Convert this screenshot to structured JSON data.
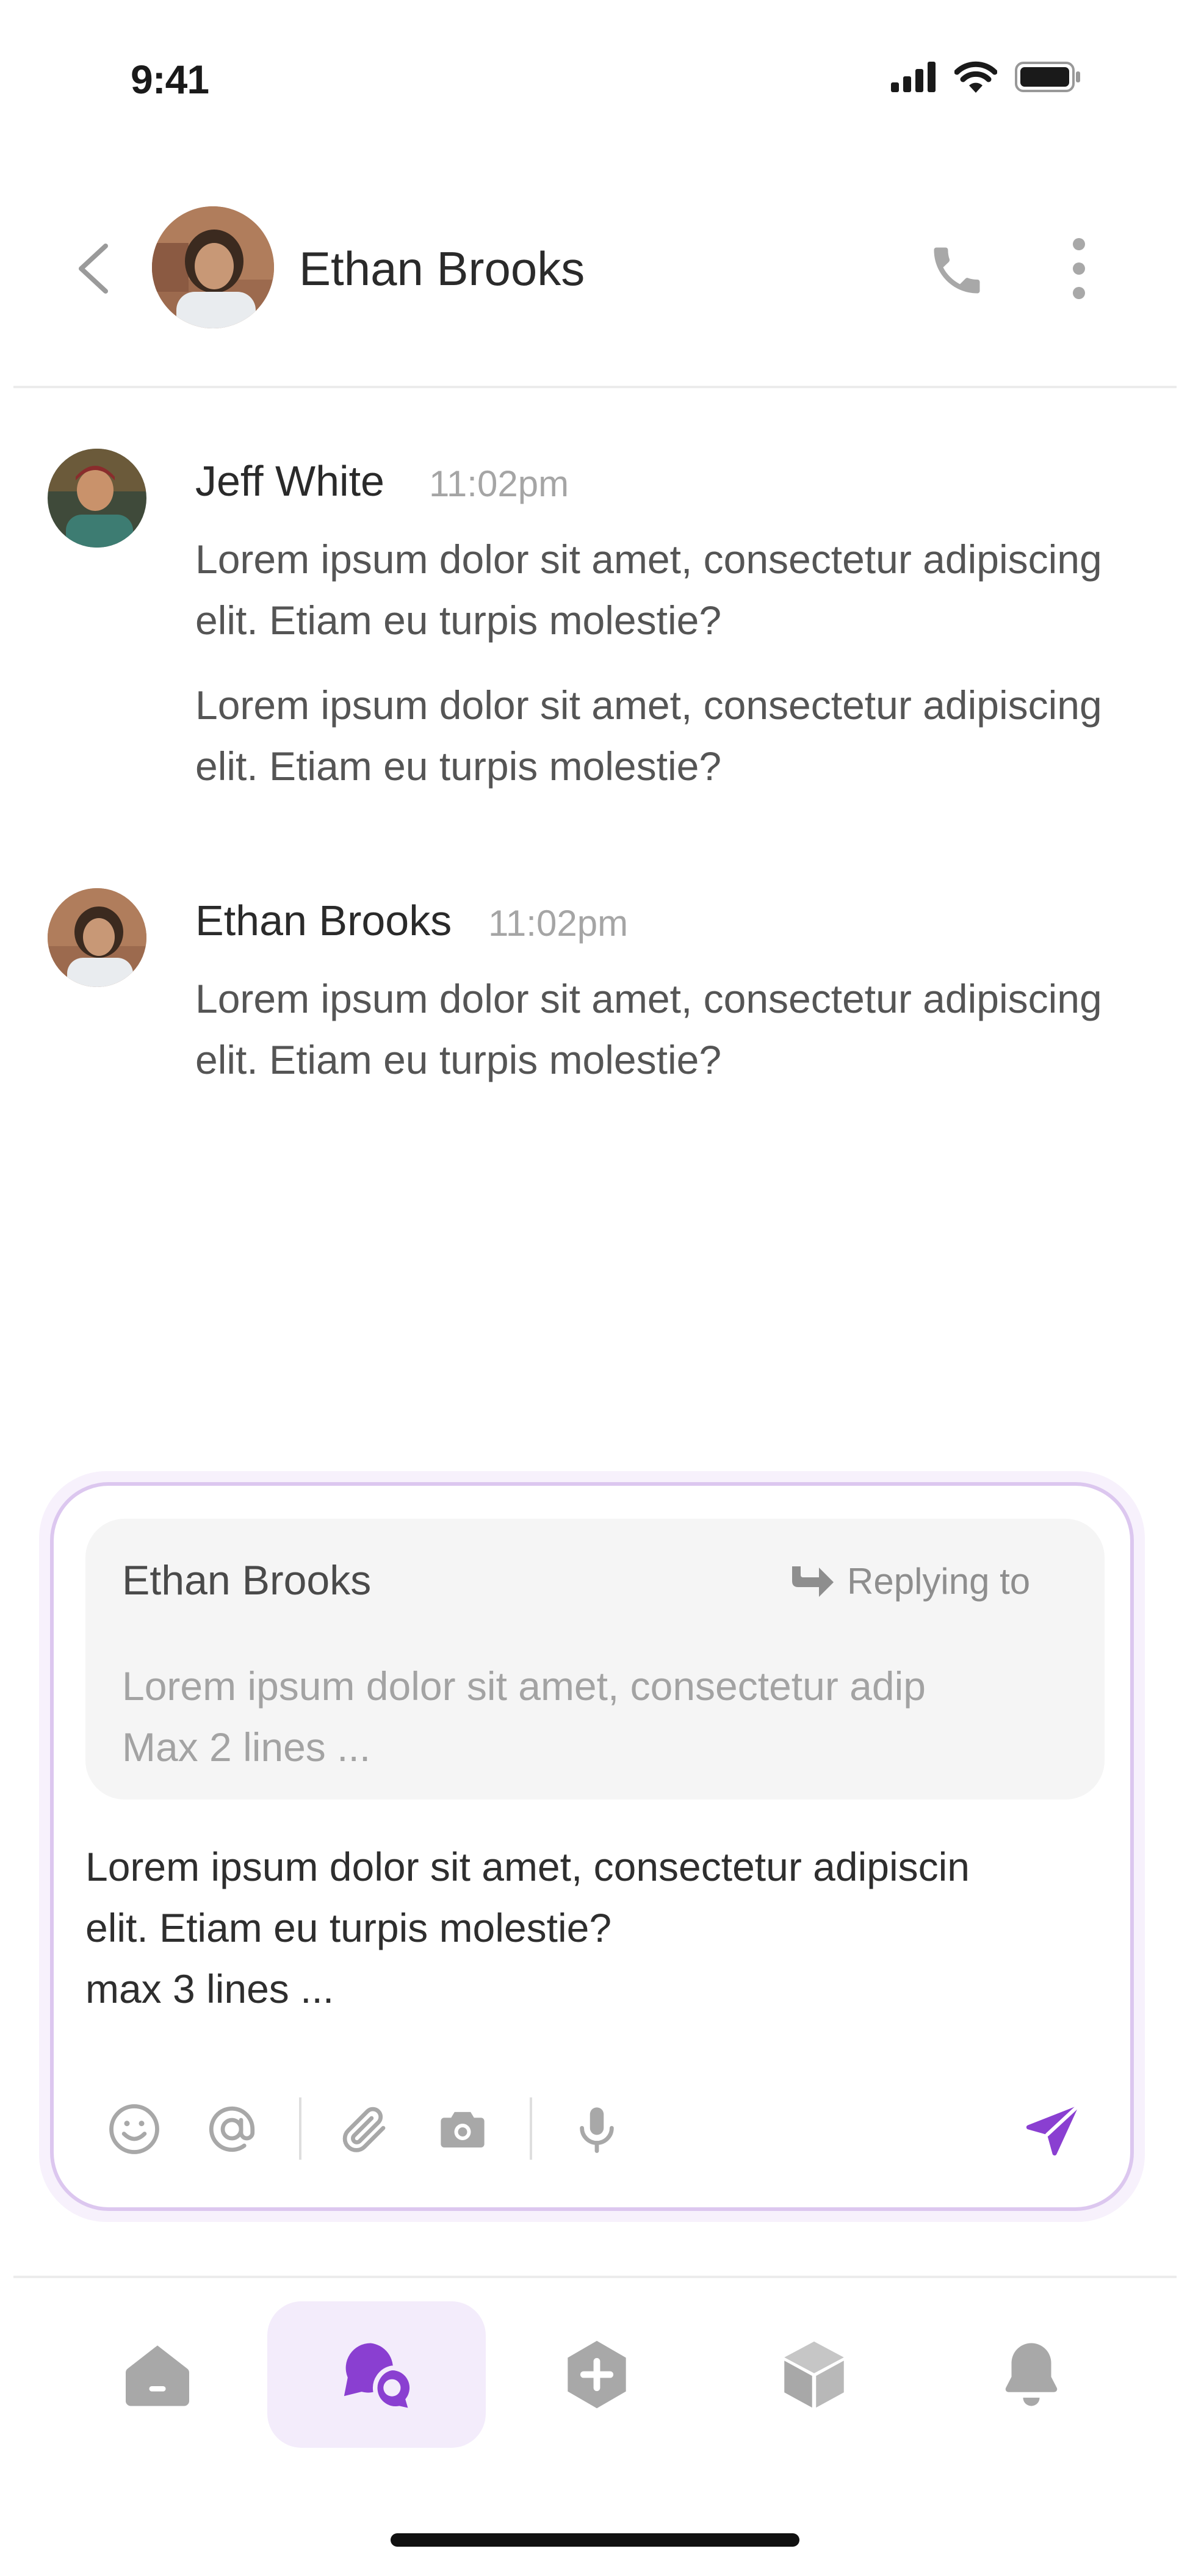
{
  "status_bar": {
    "time": "9:41"
  },
  "header": {
    "title": "Ethan Brooks"
  },
  "messages": [
    {
      "author": "Jeff White",
      "time": "11:02pm",
      "paragraphs": [
        "Lorem ipsum dolor sit amet, consectetur adipiscing elit. Etiam eu turpis molestie?",
        "Lorem ipsum dolor sit amet, consectetur adipiscing elit. Etiam eu turpis molestie?"
      ]
    },
    {
      "author": "Ethan Brooks",
      "time": "11:02pm",
      "paragraphs": [
        "Lorem ipsum dolor sit amet, consectetur adipiscing elit. Etiam eu turpis molestie?"
      ]
    }
  ],
  "composer": {
    "reply": {
      "name": "Ethan Brooks",
      "label": "Replying to",
      "text_line1": "Lorem ipsum dolor sit amet, consectetur adip",
      "text_line2": "Max 2 lines ..."
    },
    "input_line1": "Lorem ipsum dolor sit amet, consectetur adipiscin",
    "input_line2": "elit. Etiam eu turpis molestie?",
    "input_line3": "max 3 lines ...",
    "tools": [
      "emoji-icon",
      "mention-icon",
      "paperclip-icon",
      "camera-icon",
      "microphone-icon"
    ],
    "send_icon": "send-icon"
  },
  "nav": {
    "items": [
      "home-icon",
      "chat-icon",
      "add-icon",
      "box-icon",
      "bell-icon"
    ],
    "active": "chat-icon"
  },
  "colors": {
    "accent": "#8a3fd1",
    "accent_soft": "#f3ecfb",
    "composer_border": "#dcc7ef",
    "icon_gray": "#a8a8a8"
  }
}
